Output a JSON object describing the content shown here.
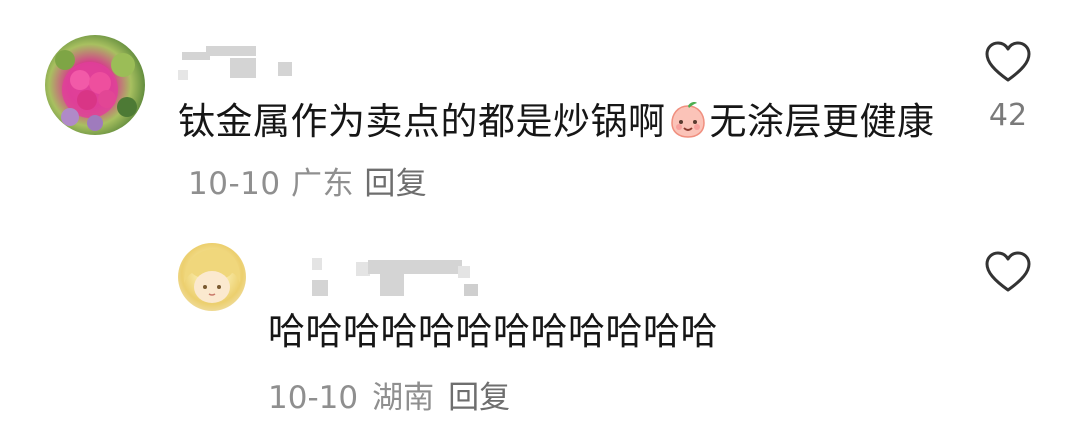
{
  "comments": [
    {
      "text_before_emoji": "钛金属作为卖点的都是炒锅啊",
      "emoji": "smiling-peach-emoji",
      "text_after_emoji": "无涂层更健康",
      "date": "10-10",
      "location": "广东",
      "reply_label": "回复",
      "like_count": "42"
    },
    {
      "text": "哈哈哈哈哈哈哈哈哈哈哈哈",
      "date": "10-10",
      "location": "湖南",
      "reply_label": "回复"
    }
  ],
  "icons": {
    "like": "heart-outline-icon",
    "avatar_main": "flower-bouquet-avatar",
    "avatar_reply": "anime-character-avatar"
  }
}
